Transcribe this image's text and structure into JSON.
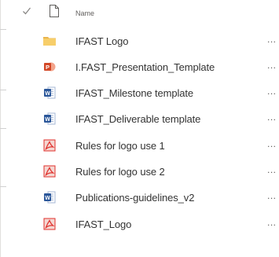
{
  "header": {
    "check_icon": "checkmark-icon",
    "doc_icon": "document-outline-icon",
    "name_label": "Name"
  },
  "files": [
    {
      "name": "IFAST Logo",
      "icon": "folder-icon"
    },
    {
      "name": "I.FAST_Presentation_Template",
      "icon": "powerpoint-file-icon"
    },
    {
      "name": "IFAST_Milestone template",
      "icon": "word-file-icon"
    },
    {
      "name": "IFAST_Deliverable template",
      "icon": "word-file-icon"
    },
    {
      "name": "Rules for logo use 1",
      "icon": "pdf-file-icon"
    },
    {
      "name": "Rules for logo use 2",
      "icon": "pdf-file-icon"
    },
    {
      "name": "Publications-guidelines_v2",
      "icon": "word-file-icon"
    },
    {
      "name": "IFAST_Logo",
      "icon": "pdf-file-icon"
    }
  ],
  "more_label": "...",
  "colors": {
    "folder": "#f7ce6a",
    "word": "#2b579a",
    "powerpoint": "#d24726",
    "pdf": "#e0302c"
  }
}
